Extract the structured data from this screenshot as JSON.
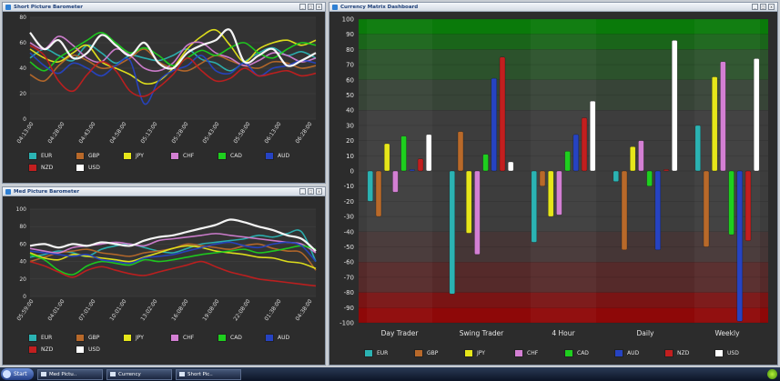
{
  "windows": {
    "short": {
      "title": "Short Picture Barometer"
    },
    "med": {
      "title": "Med Picture Barometer"
    },
    "matrix": {
      "title": "Currency Matrix Dashboard"
    }
  },
  "currencies": [
    {
      "name": "EUR",
      "color": "#2bb3b3"
    },
    {
      "name": "GBP",
      "color": "#b8692a"
    },
    {
      "name": "JPY",
      "color": "#e6e61a"
    },
    {
      "name": "CHF",
      "color": "#d37fd3"
    },
    {
      "name": "CAD",
      "color": "#1ecf1e"
    },
    {
      "name": "AUD",
      "color": "#2643c2"
    },
    {
      "name": "NZD",
      "color": "#c21f1f"
    },
    {
      "name": "USD",
      "color": "#ffffff"
    }
  ],
  "taskbar": {
    "start": "Start",
    "items": [
      "Med Pictu..",
      "Currency",
      "Short Pic.."
    ]
  },
  "chart_data": [
    {
      "type": "line",
      "ylim": [
        0,
        80
      ],
      "yticks": [
        0,
        20,
        40,
        60,
        80
      ],
      "x": [
        "04:13:00",
        "04:28:00",
        "04:43:00",
        "04:58:00",
        "05:13:00",
        "05:28:00",
        "05:43:00",
        "05:58:00",
        "06:13:00",
        "06:28:00"
      ],
      "series": [
        {
          "name": "EUR",
          "values": [
            48,
            55,
            50,
            46,
            58,
            52,
            44,
            50,
            48,
            46,
            50,
            55,
            47,
            44,
            38,
            45,
            52,
            56,
            50,
            53,
            48
          ]
        },
        {
          "name": "GBP",
          "values": [
            35,
            30,
            42,
            50,
            46,
            40,
            42,
            48,
            55,
            45,
            40,
            38,
            44,
            50,
            46,
            42,
            40,
            45,
            44,
            40,
            42
          ]
        },
        {
          "name": "JPY",
          "values": [
            55,
            48,
            45,
            52,
            58,
            45,
            40,
            35,
            28,
            30,
            40,
            55,
            65,
            70,
            58,
            45,
            55,
            60,
            62,
            58,
            62
          ]
        },
        {
          "name": "CHF",
          "values": [
            60,
            55,
            65,
            58,
            48,
            45,
            55,
            50,
            40,
            38,
            44,
            58,
            60,
            52,
            48,
            42,
            46,
            52,
            50,
            45,
            48
          ]
        },
        {
          "name": "CAD",
          "values": [
            45,
            38,
            48,
            55,
            62,
            68,
            60,
            52,
            56,
            50,
            42,
            48,
            54,
            50,
            56,
            60,
            52,
            48,
            55,
            60,
            58
          ]
        },
        {
          "name": "AUD",
          "values": [
            52,
            42,
            36,
            44,
            40,
            34,
            42,
            46,
            12,
            30,
            38,
            42,
            50,
            38,
            36,
            44,
            34,
            40,
            42,
            46,
            44
          ]
        },
        {
          "name": "NZD",
          "values": [
            58,
            50,
            30,
            22,
            35,
            45,
            38,
            22,
            18,
            25,
            35,
            48,
            38,
            30,
            32,
            40,
            34,
            36,
            38,
            34,
            36
          ]
        },
        {
          "name": "USD",
          "values": [
            68,
            55,
            62,
            48,
            52,
            66,
            58,
            50,
            60,
            44,
            40,
            52,
            58,
            62,
            70,
            45,
            50,
            55,
            42,
            46,
            52
          ]
        }
      ]
    },
    {
      "type": "line",
      "ylim": [
        0,
        100
      ],
      "yticks": [
        0,
        20,
        40,
        60,
        80,
        100
      ],
      "x": [
        "05:59:00",
        "04:01:00",
        "07:01:00",
        "10:01:00",
        "13:02:00",
        "16:08:00",
        "19:08:00",
        "22:08:00",
        "01:38:00",
        "04:38:00"
      ],
      "series": [
        {
          "name": "EUR",
          "values": [
            45,
            48,
            52,
            50,
            46,
            54,
            58,
            60,
            56,
            52,
            50,
            55,
            60,
            62,
            64,
            66,
            70,
            68,
            72,
            74,
            40
          ]
        },
        {
          "name": "GBP",
          "values": [
            40,
            45,
            50,
            52,
            54,
            50,
            48,
            46,
            50,
            52,
            55,
            60,
            58,
            56,
            54,
            58,
            60,
            55,
            52,
            50,
            30
          ]
        },
        {
          "name": "JPY",
          "values": [
            50,
            44,
            42,
            48,
            46,
            44,
            42,
            40,
            45,
            50,
            55,
            58,
            56,
            52,
            50,
            48,
            45,
            44,
            40,
            38,
            32
          ]
        },
        {
          "name": "CHF",
          "values": [
            55,
            52,
            50,
            56,
            58,
            60,
            62,
            60,
            58,
            64,
            66,
            68,
            70,
            72,
            70,
            68,
            66,
            64,
            62,
            60,
            50
          ]
        },
        {
          "name": "CAD",
          "values": [
            48,
            42,
            30,
            25,
            35,
            40,
            38,
            36,
            42,
            40,
            42,
            45,
            48,
            50,
            52,
            54,
            50,
            52,
            55,
            58,
            54
          ]
        },
        {
          "name": "AUD",
          "values": [
            52,
            50,
            48,
            46,
            48,
            42,
            40,
            38,
            44,
            46,
            48,
            52,
            56,
            60,
            62,
            58,
            56,
            60,
            62,
            58,
            40
          ]
        },
        {
          "name": "NZD",
          "values": [
            40,
            35,
            28,
            22,
            30,
            34,
            30,
            26,
            24,
            28,
            32,
            36,
            40,
            34,
            28,
            24,
            20,
            18,
            16,
            14,
            12
          ]
        },
        {
          "name": "USD",
          "values": [
            58,
            60,
            56,
            60,
            58,
            62,
            60,
            58,
            64,
            68,
            70,
            74,
            78,
            82,
            88,
            85,
            80,
            76,
            70,
            66,
            52
          ]
        }
      ]
    },
    {
      "type": "bar",
      "ylim": [
        -100,
        100
      ],
      "yticks": [
        100,
        90,
        80,
        70,
        60,
        50,
        40,
        30,
        20,
        10,
        0,
        -10,
        -20,
        -30,
        -40,
        -50,
        -60,
        -70,
        -80,
        -90,
        -100
      ],
      "categories": [
        "Day Trader",
        "Swing Trader",
        "4 Hour",
        "Daily",
        "Weekly"
      ],
      "series": [
        {
          "name": "EUR",
          "values": [
            -20,
            -81,
            -47,
            -7,
            30
          ]
        },
        {
          "name": "GBP",
          "values": [
            -30,
            26,
            -10,
            -52,
            -50
          ]
        },
        {
          "name": "JPY",
          "values": [
            18,
            -41,
            -30,
            16,
            62
          ]
        },
        {
          "name": "CHF",
          "values": [
            -14,
            -55,
            -29,
            20,
            72
          ]
        },
        {
          "name": "CAD",
          "values": [
            23,
            11,
            13,
            -10,
            -42
          ]
        },
        {
          "name": "AUD",
          "values": [
            1,
            61,
            24,
            -52,
            -99
          ]
        },
        {
          "name": "NZD",
          "values": [
            8,
            75,
            35,
            1,
            -46
          ]
        },
        {
          "name": "USD",
          "values": [
            24,
            6,
            46,
            86,
            74
          ]
        }
      ]
    }
  ]
}
